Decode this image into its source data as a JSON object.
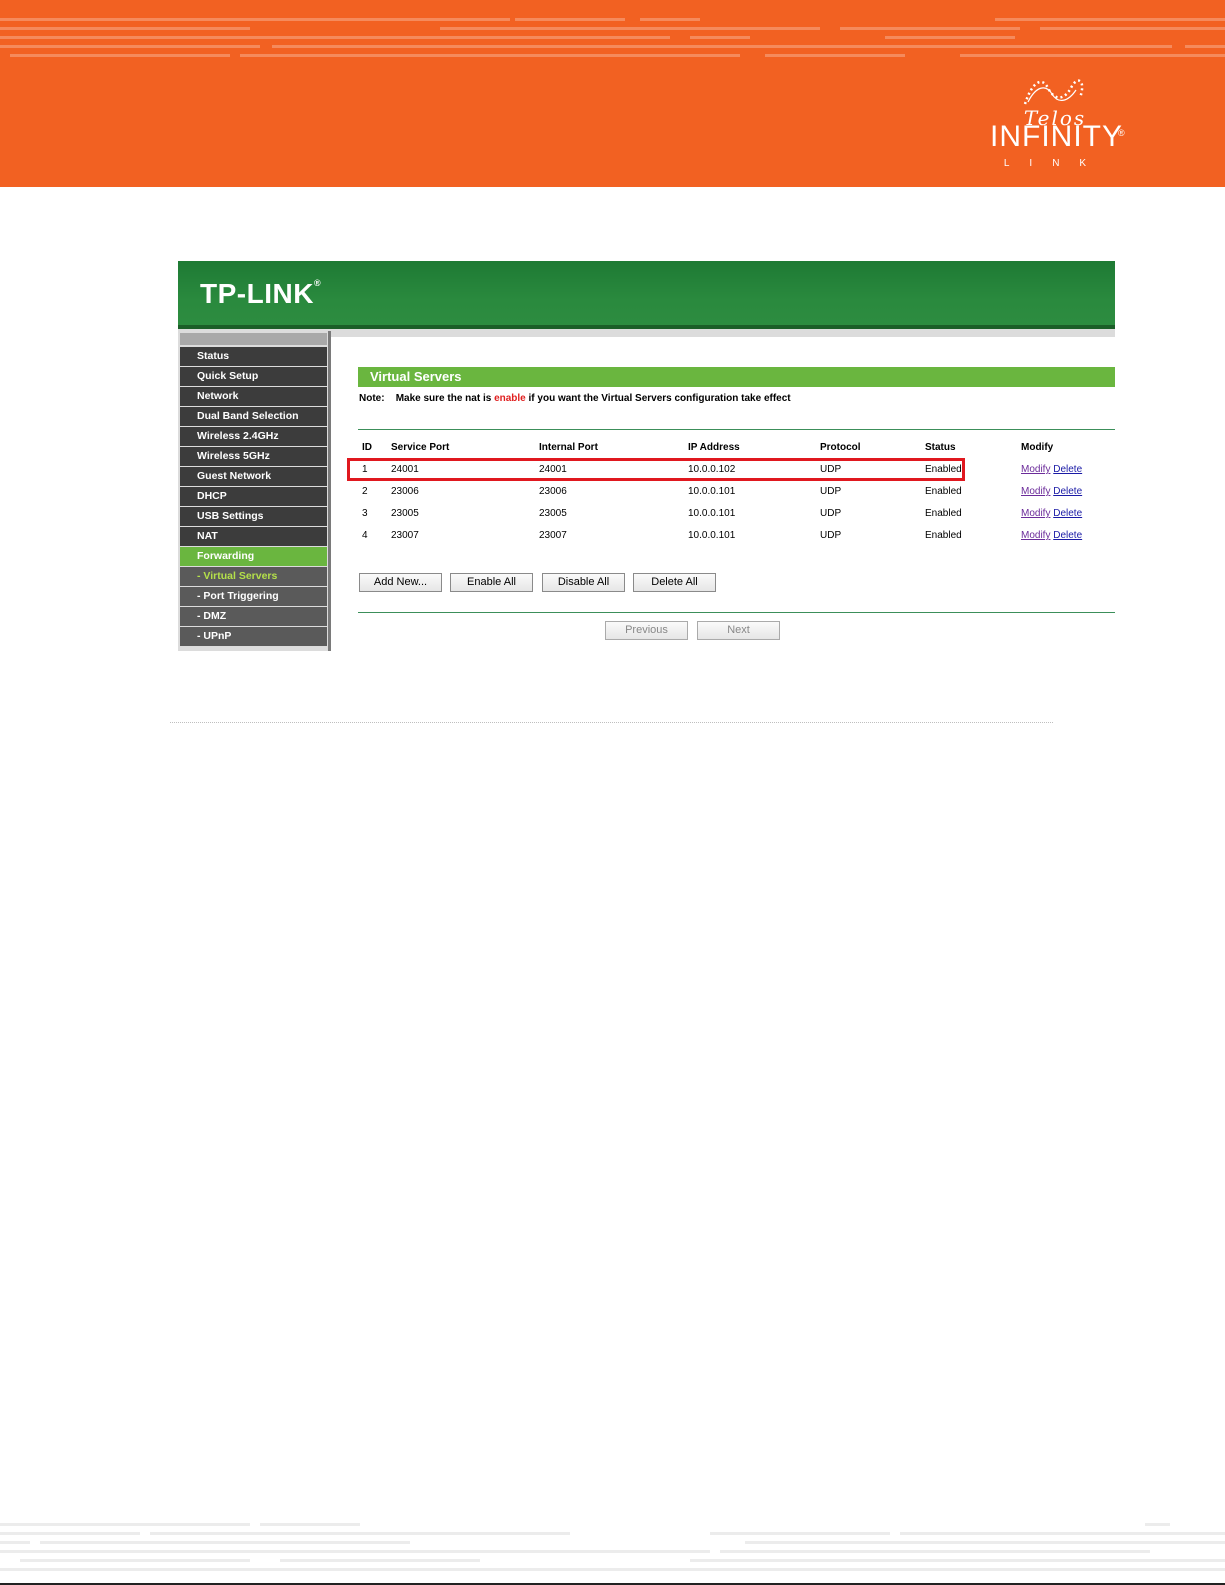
{
  "banner": {
    "logo": {
      "script": "Telos",
      "main": "INFINITY",
      "registered": "®",
      "sub": "LINK"
    }
  },
  "router": {
    "brand": "TP-LINK",
    "brand_registered": "®",
    "sidebar": {
      "items": [
        {
          "label": "Status",
          "state": "normal"
        },
        {
          "label": "Quick Setup",
          "state": "normal"
        },
        {
          "label": "Network",
          "state": "normal"
        },
        {
          "label": "Dual Band Selection",
          "state": "normal"
        },
        {
          "label": "Wireless 2.4GHz",
          "state": "normal"
        },
        {
          "label": "Wireless 5GHz",
          "state": "normal"
        },
        {
          "label": "Guest Network",
          "state": "normal"
        },
        {
          "label": "DHCP",
          "state": "normal"
        },
        {
          "label": "USB Settings",
          "state": "normal"
        },
        {
          "label": "NAT",
          "state": "normal"
        },
        {
          "label": "Forwarding",
          "state": "active"
        },
        {
          "label": "- Virtual Servers",
          "state": "sub-current"
        },
        {
          "label": "- Port Triggering",
          "state": "sub"
        },
        {
          "label": "- DMZ",
          "state": "sub"
        },
        {
          "label": "- UPnP",
          "state": "sub"
        }
      ]
    },
    "page_title": "Virtual Servers",
    "note": {
      "label": "Note:",
      "before": "Make sure the nat is ",
      "highlight": "enable",
      "after": " if you want the Virtual Servers configuration take effect"
    },
    "table": {
      "headers": {
        "id": "ID",
        "service_port": "Service Port",
        "internal_port": "Internal Port",
        "ip_address": "IP Address",
        "protocol": "Protocol",
        "status": "Status",
        "modify": "Modify"
      },
      "rows": [
        {
          "id": "1",
          "service_port": "24001",
          "internal_port": "24001",
          "ip_address": "10.0.0.102",
          "protocol": "UDP",
          "status": "Enabled",
          "modify": "Modify",
          "delete": "Delete"
        },
        {
          "id": "2",
          "service_port": "23006",
          "internal_port": "23006",
          "ip_address": "10.0.0.101",
          "protocol": "UDP",
          "status": "Enabled",
          "modify": "Modify",
          "delete": "Delete"
        },
        {
          "id": "3",
          "service_port": "23005",
          "internal_port": "23005",
          "ip_address": "10.0.0.101",
          "protocol": "UDP",
          "status": "Enabled",
          "modify": "Modify",
          "delete": "Delete"
        },
        {
          "id": "4",
          "service_port": "23007",
          "internal_port": "23007",
          "ip_address": "10.0.0.101",
          "protocol": "UDP",
          "status": "Enabled",
          "modify": "Modify",
          "delete": "Delete"
        }
      ]
    },
    "buttons": {
      "add_new": "Add New...",
      "enable_all": "Enable All",
      "disable_all": "Disable All",
      "delete_all": "Delete All",
      "previous": "Previous",
      "next": "Next"
    }
  },
  "colors": {
    "banner_orange": "#f26122",
    "router_green": "#2a8a3e",
    "accent_green": "#6ab63f",
    "highlight_red": "#e0181f",
    "link_blue": "#1a1aa6"
  }
}
